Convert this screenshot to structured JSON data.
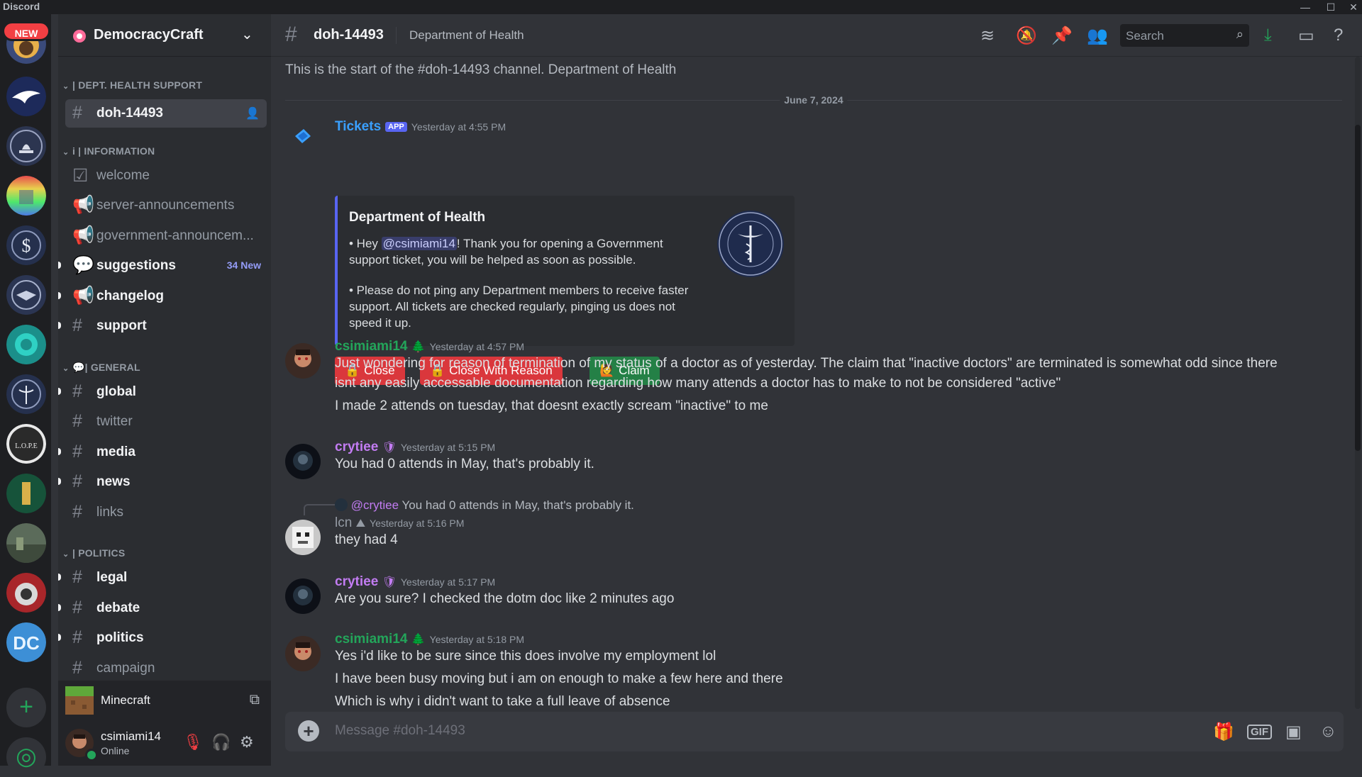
{
  "app": {
    "brand": "Discord",
    "new_badge": "NEW"
  },
  "server": {
    "name": "DemocracyCraft"
  },
  "categories": {
    "dept": "| DEPT. HEALTH SUPPORT",
    "info": "i | INFORMATION",
    "general": "| GENERAL",
    "politics": "| POLITICS"
  },
  "channels": [
    {
      "label": "doh-14493",
      "state": "selected"
    },
    {
      "label": "welcome",
      "state": "read"
    },
    {
      "label": "server-announcements",
      "state": "read"
    },
    {
      "label": "government-announcem...",
      "state": "read"
    },
    {
      "label": "suggestions",
      "state": "unread",
      "new": "34 New"
    },
    {
      "label": "changelog",
      "state": "unread"
    },
    {
      "label": "support",
      "state": "unread"
    },
    {
      "label": "global",
      "state": "unread"
    },
    {
      "label": "twitter",
      "state": "read"
    },
    {
      "label": "media",
      "state": "unread"
    },
    {
      "label": "news",
      "state": "unread"
    },
    {
      "label": "links",
      "state": "read"
    },
    {
      "label": "legal",
      "state": "unread"
    },
    {
      "label": "debate",
      "state": "unread"
    },
    {
      "label": "politics",
      "state": "unread"
    },
    {
      "label": "campaign",
      "state": "read"
    }
  ],
  "activity": {
    "name": "Minecraft"
  },
  "user": {
    "name": "csimiami14",
    "status": "Online"
  },
  "header": {
    "channel": "doh-14493",
    "topic": "Department of Health",
    "search_placeholder": "Search"
  },
  "chat": {
    "welcome": "This is the start of the #doh-14493 channel. Department of Health",
    "date": "June 7, 2024",
    "tickets": {
      "name": "Tickets",
      "badge": "APP",
      "time": "Yesterday at 4:55 PM",
      "embed_title": "Department of Health",
      "p1_pre": "• Hey ",
      "p1_mention": "@csimiami14",
      "p1_post": "! Thank you for opening a Government support ticket, you will be helped as soon as possible.",
      "p2": "• Please do not ping any Department members to receive faster support. All tickets are checked regularly, pinging us does not speed it up.",
      "btn_close": "Close",
      "btn_close_reason": "Close With Reason",
      "btn_claim": "Claim"
    },
    "m1": {
      "name": "csimiami14",
      "time": "Yesterday at 4:57 PM",
      "l1": "Just wondering for reason of termination of my status of a doctor as of yesterday. The claim that \"inactive doctors\" are terminated is somewhat odd since there",
      "l2": "isnt any easily accessable documentation regarding how many attends a doctor has to make to not be considered \"active\"",
      "l3": "I made 2 attends on tuesday, that doesnt exactly scream \"inactive\" to me"
    },
    "m2": {
      "name": "crytiee",
      "time": "Yesterday at 5:15 PM",
      "l1": "You had 0 attends in May, that's probably it."
    },
    "m3": {
      "reply_name": "@crytiee",
      "reply_text": "You had 0 attends in May, that's probably it.",
      "name": "lcn",
      "time": "Yesterday at 5:16 PM",
      "l1": "they had 4"
    },
    "m4": {
      "name": "crytiee",
      "time": "Yesterday at 5:17 PM",
      "l1": "Are you sure? I checked the dotm doc like 2 minutes ago"
    },
    "m5": {
      "name": "csimiami14",
      "time": "Yesterday at 5:18 PM",
      "l1": "Yes i'd like to be sure since this does involve my employment lol",
      "l2": "I have been busy moving but i am on enough to make a few here and there",
      "l3": "Which is why i didn't want to take a full leave of absence"
    }
  },
  "composer": {
    "placeholder": "Message #doh-14493"
  },
  "colors": {
    "accent": "#5865f2",
    "green_name": "#23a55a",
    "purple_name": "#c27cf2",
    "red_button": "#da373c",
    "green_button": "#248046"
  }
}
